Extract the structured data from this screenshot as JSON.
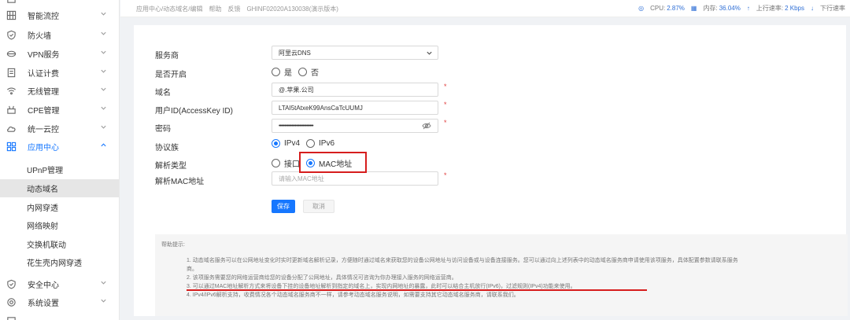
{
  "sidebar": {
    "items": [
      {
        "label": "",
        "icon": "network-icon"
      },
      {
        "label": "智能流控",
        "icon": "grid-icon"
      },
      {
        "label": "防火墙",
        "icon": "shield-icon"
      },
      {
        "label": "VPN服务",
        "icon": "vpn-icon"
      },
      {
        "label": "认证计费",
        "icon": "document-icon"
      },
      {
        "label": "无线管理",
        "icon": "wifi-icon"
      },
      {
        "label": "CPE管理",
        "icon": "cpe-icon"
      },
      {
        "label": "统一云控",
        "icon": "cloud-icon"
      },
      {
        "label": "应用中心",
        "icon": "apps-icon"
      }
    ],
    "sub_items": [
      {
        "label": "UPnP管理"
      },
      {
        "label": "动态域名"
      },
      {
        "label": "内网穿透"
      },
      {
        "label": "网络映射"
      },
      {
        "label": "交换机联动"
      },
      {
        "label": "花生壳内网穿透"
      }
    ],
    "bottom_items": [
      {
        "label": "安全中心",
        "icon": "security-icon"
      },
      {
        "label": "系统设置",
        "icon": "gear-icon"
      }
    ]
  },
  "topbar": {
    "breadcrumb": "应用中心/动态域名/编辑",
    "links": [
      "帮助",
      "反馈"
    ],
    "device_id": "GHINF02020A130038(演示版本)",
    "cpu_label": "CPU:",
    "cpu_value": "2.87%",
    "mem_label": "内存:",
    "mem_value": "36.04%",
    "up_label": "上行速率:",
    "up_value": "2 Kbps",
    "down_label": "下行速率"
  },
  "form": {
    "provider_label": "服务商",
    "provider_value": "阿里云DNS",
    "enabled_label": "是否开启",
    "enabled_yes": "是",
    "enabled_no": "否",
    "domain_label": "域名",
    "domain_value": "@.苹果.公司",
    "user_label": "用户ID(AccessKey ID)",
    "user_value": "LTAI5tAtxeK99AnsCaTcUUMJ",
    "password_label": "密码",
    "password_value": "••••••••••••••••••••••••••••••",
    "protocol_label": "协议族",
    "protocol_ipv4": "IPv4",
    "protocol_ipv6": "IPv6",
    "resolve_label": "解析类型",
    "resolve_iface": "接口",
    "resolve_mac": "MAC地址",
    "mac_label": "解析MAC地址",
    "mac_placeholder": "请输入MAC地址",
    "required_mark": "*",
    "save_label": "保存",
    "cancel_label": "取消"
  },
  "help": {
    "title": "帮助提示:",
    "lines": [
      "1. 动态域名服务可以在公网地址变化时实时更新域名解析记录，方便随时通过域名来获取您的设备公网地址与访问设备或与设备连接服务。您可以通过向上述列表中的动态域名服务商申请使用该项服务，具体配置参数请联系服务",
      "商。",
      "2. 该项服务需要您的网络运营商给您的设备分配了公网地址，具体情况可咨询为你办理接入服务的网络运营商。",
      "3. 可以通过MAC地址解析方式来将设备下挂的设备地址解析到指定的域名上，实现内网地址的暴露，此时可以结合主机放行(IPv6)，过滤规则(IPv4)功能来使用。",
      "4. IPv4/IPv6解析支持，收费情况各个动态域名服务商不一样，请参考动态域名服务说明，如需要支持其它动态域名服务商，请联系我们。"
    ]
  },
  "colors": {
    "accent": "#1677ff",
    "annotation_red": "#d61d1d"
  }
}
